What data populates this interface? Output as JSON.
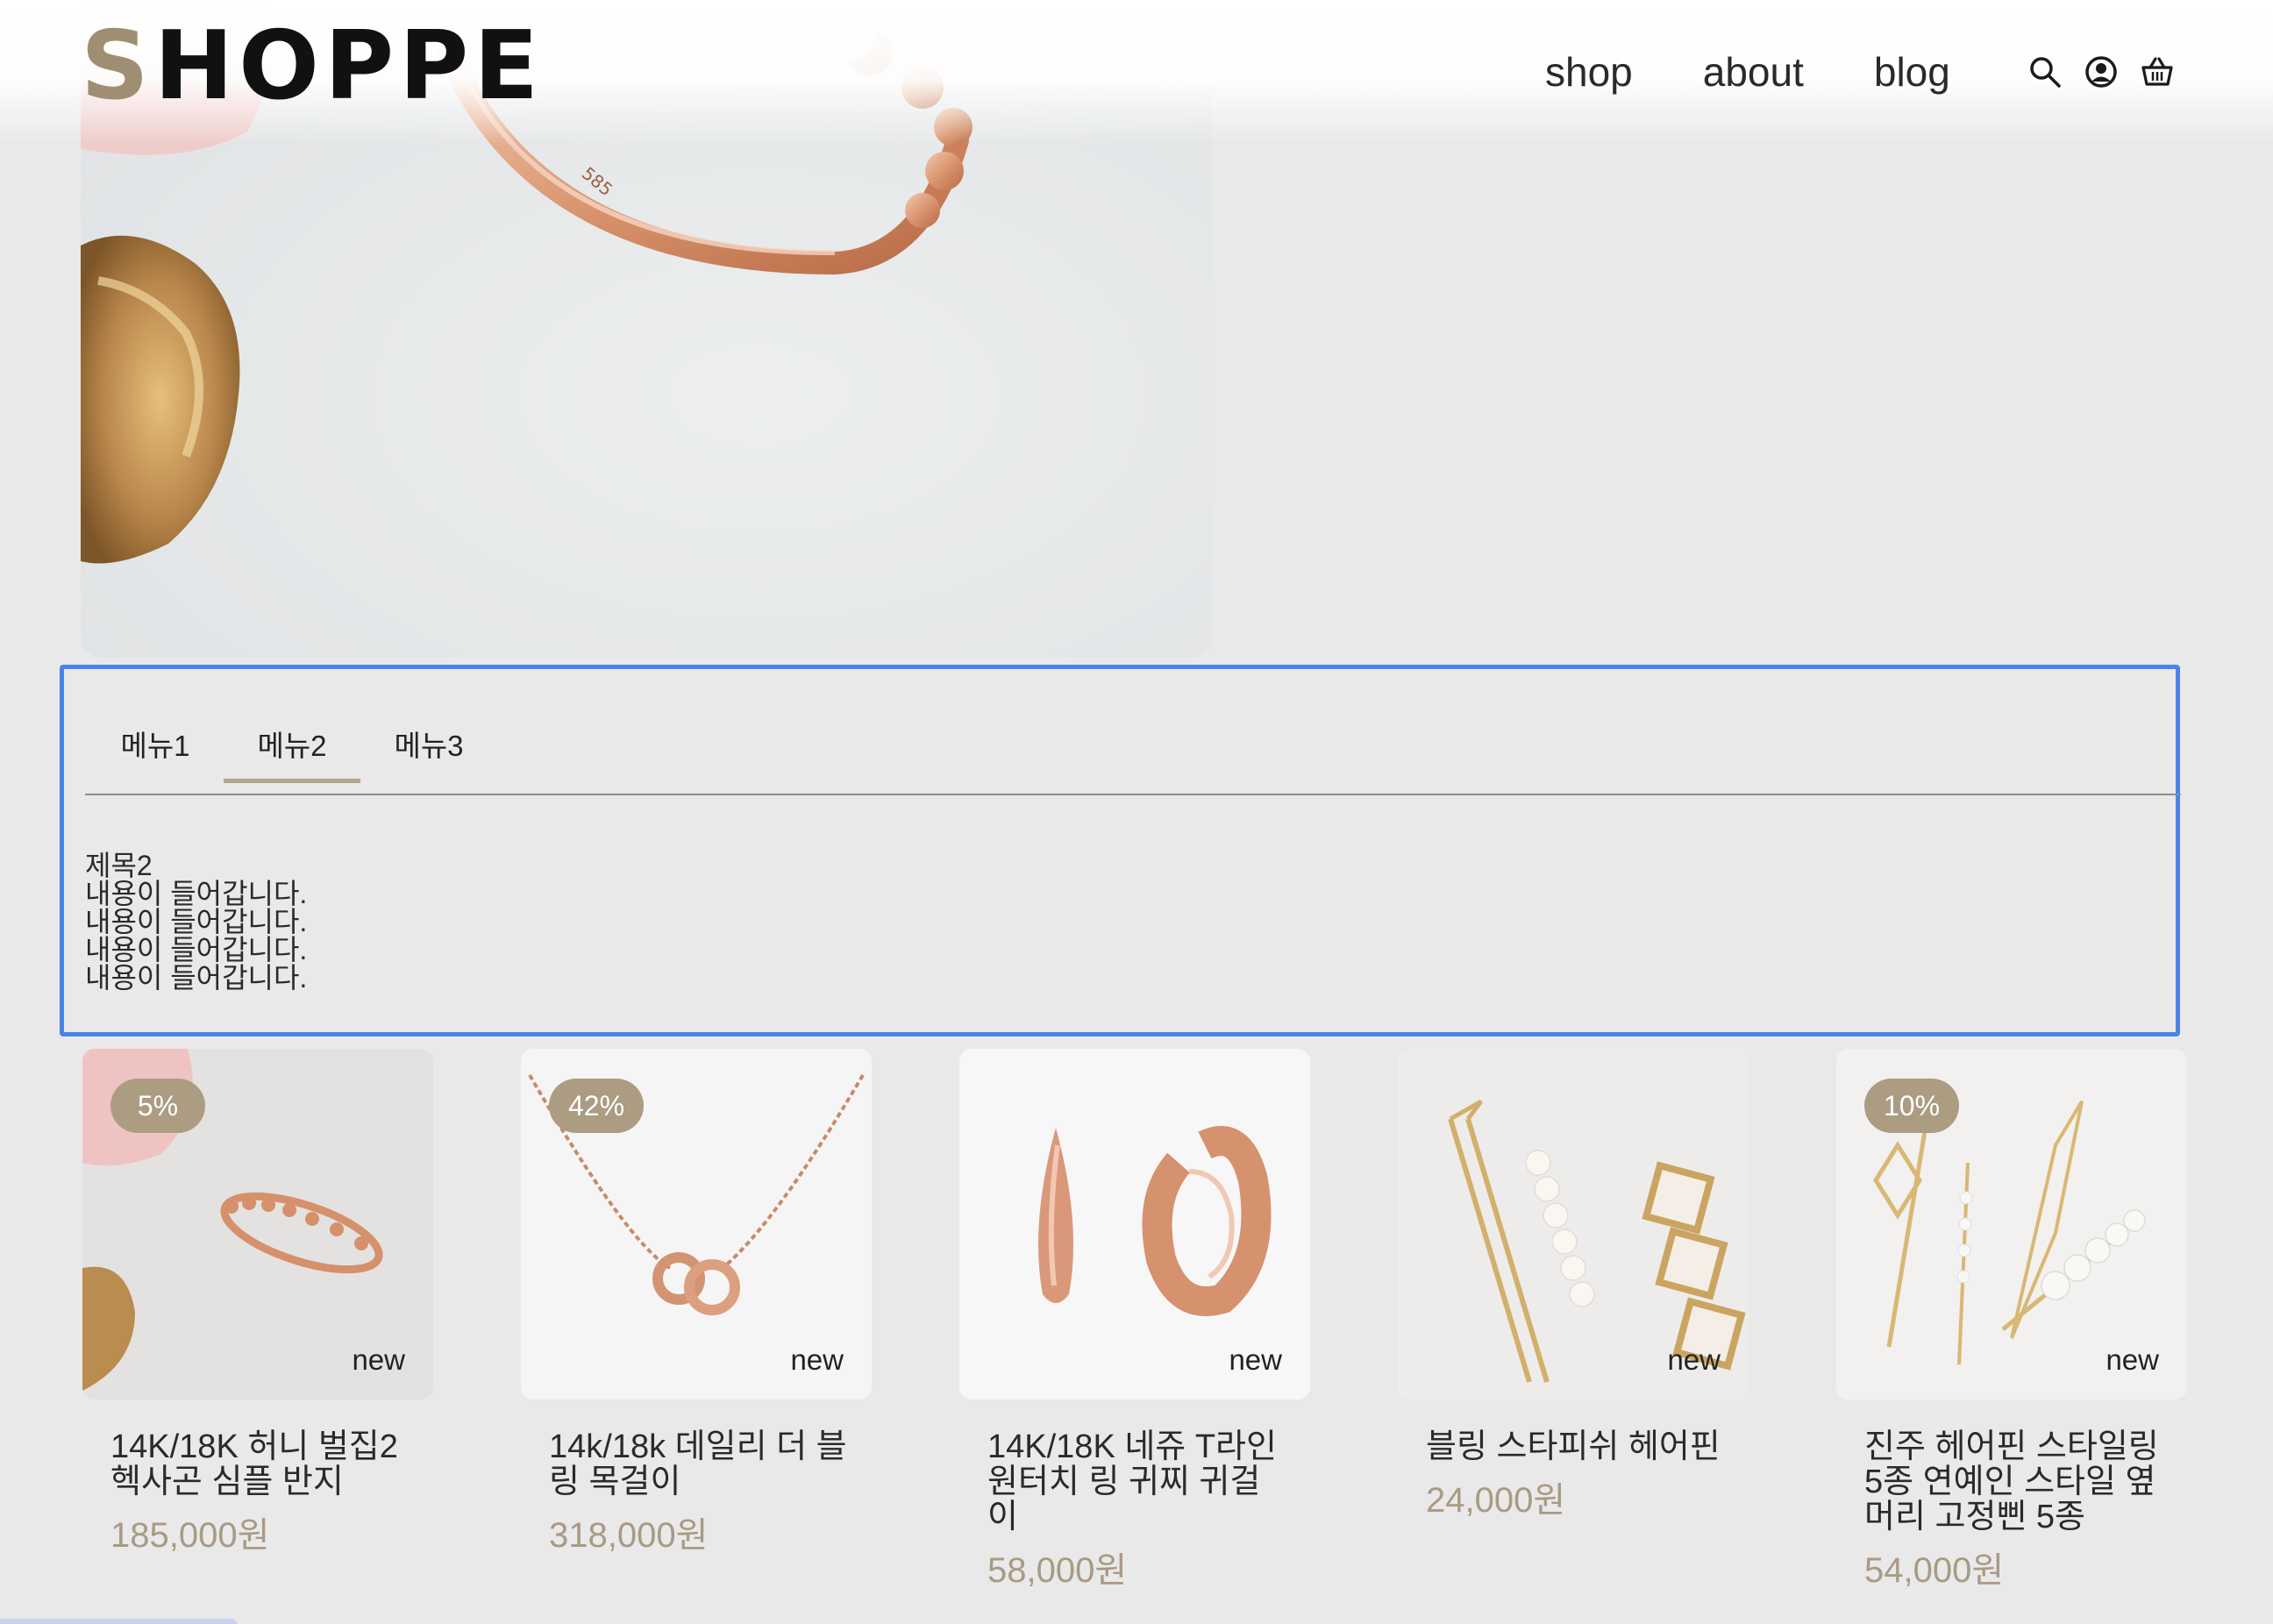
{
  "header": {
    "logo": "SHOPPE",
    "logo_first": "S",
    "logo_rest": "HOPPE",
    "nav": [
      "shop",
      "about",
      "blog"
    ],
    "icons": [
      "search-icon",
      "user-icon",
      "cart-icon"
    ]
  },
  "tabs": {
    "items": [
      "메뉴1",
      "메뉴2",
      "메뉴3"
    ],
    "active_index": 1,
    "content": {
      "title": "제목2",
      "lines": [
        "내용이 들어갑니다.",
        "내용이 들어갑니다.",
        "내용이 들어갑니다.",
        "내용이 들어갑니다."
      ]
    }
  },
  "products": [
    {
      "name": "14K/18K 허니 벌집2 헥사곤 심플 반지",
      "price": "185,000원",
      "badge": "5%",
      "tag": "new"
    },
    {
      "name": "14k/18k 데일리 더 블링 목걸이",
      "price": "318,000원",
      "badge": "42%",
      "tag": "new"
    },
    {
      "name": "14K/18K 네쥬 T라인 원터치 링 귀찌 귀걸이",
      "price": "58,000원",
      "badge": "",
      "tag": "new"
    },
    {
      "name": "블링 스타피쉬 헤어핀",
      "price": "24,000원",
      "badge": "",
      "tag": "new"
    },
    {
      "name": "진주 헤어핀 스타일링 5종 연예인 스타일 옆머리 고정삔 5종",
      "price": "54,000원",
      "badge": "10%",
      "tag": "new"
    }
  ],
  "colors": {
    "accent": "#ab9c82",
    "price": "#a99a84",
    "panel_outline": "#4b84e6",
    "background": "#e9e9e9"
  }
}
